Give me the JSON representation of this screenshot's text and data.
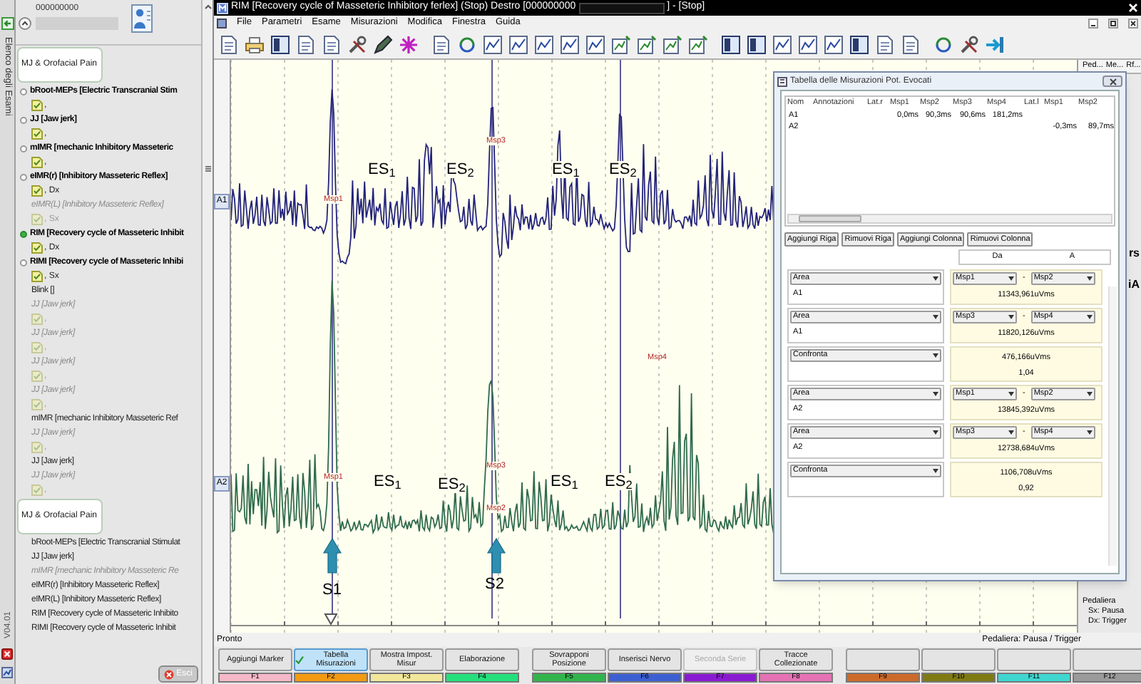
{
  "window": {
    "title": "RIM [Recovery cycle of Masseteric Inhibitory ferlex] (Stop) Destro [000000000",
    "title_end": "] - [Stop]"
  },
  "menu": [
    "File",
    "Parametri",
    "Esame",
    "Misurazioni",
    "Modifica",
    "Finestra",
    "Guida"
  ],
  "sidebar": {
    "tab_label": "Elenco degli Esami",
    "patient_id": "000000000",
    "version": "V04.01",
    "exit_button": "Esci",
    "groups": [
      {
        "title": "MJ & Orofacial Pain",
        "items": [
          {
            "kind": "exam",
            "text": "bRoot-MEPs [Electric Transcranial Stim",
            "active": false
          },
          {
            "kind": "file",
            "text": ",",
            "dimmed": false
          },
          {
            "kind": "exam",
            "text": "JJ [Jaw jerk]",
            "active": false
          },
          {
            "kind": "file",
            "text": ",",
            "dimmed": false
          },
          {
            "kind": "exam",
            "text": "mIMR [mechanic Inhibitory Masseteric",
            "active": false
          },
          {
            "kind": "file",
            "text": ",",
            "dimmed": false
          },
          {
            "kind": "exam",
            "text": "eIMR(r) [Inhibitory Masseteric Reflex]",
            "active": false
          },
          {
            "kind": "file",
            "text": ", Dx",
            "dimmed": false
          },
          {
            "kind": "note",
            "text": "eIMR(L) [Inhibitory Masseteric Reflex]"
          },
          {
            "kind": "file",
            "text": ", Sx",
            "dimmed": true
          },
          {
            "kind": "exam",
            "text": "RIM [Recovery cycle of Masseteric Inhibit",
            "active": true
          },
          {
            "kind": "file",
            "text": ", Dx",
            "dimmed": false
          },
          {
            "kind": "exam",
            "text": "RIMI [Recovery cycle of Masseteric Inhibi",
            "active": false
          },
          {
            "kind": "file",
            "text": ", Sx",
            "dimmed": false
          },
          {
            "kind": "entry",
            "text": "Blink []"
          },
          {
            "kind": "note",
            "text": "JJ [Jaw jerk]"
          },
          {
            "kind": "file",
            "text": ",",
            "dimmed": true
          },
          {
            "kind": "note",
            "text": "JJ [Jaw jerk]"
          },
          {
            "kind": "file",
            "text": ",",
            "dimmed": true
          },
          {
            "kind": "note",
            "text": "JJ [Jaw jerk]"
          },
          {
            "kind": "file",
            "text": ",",
            "dimmed": true
          },
          {
            "kind": "note",
            "text": "JJ [Jaw jerk]"
          },
          {
            "kind": "file",
            "text": ",",
            "dimmed": true
          },
          {
            "kind": "entry",
            "text": "mIMR [mechanic Inhibitory Masseteric Ref"
          },
          {
            "kind": "note",
            "text": "JJ [Jaw jerk]"
          },
          {
            "kind": "file",
            "text": ",",
            "dimmed": true
          },
          {
            "kind": "entry",
            "text": "JJ [Jaw jerk]"
          },
          {
            "kind": "note",
            "text": "JJ [Jaw jerk]"
          },
          {
            "kind": "file",
            "text": ",",
            "dimmed": true
          }
        ]
      },
      {
        "title": "MJ & Orofacial Pain",
        "items": [
          {
            "kind": "entry",
            "text": "bRoot-MEPs [Electric Transcranial Stimulat"
          },
          {
            "kind": "entry",
            "text": "JJ [Jaw jerk]"
          },
          {
            "kind": "note",
            "text": "mIMR [mechanic Inhibitory Masseteric Re"
          },
          {
            "kind": "entry",
            "text": "eIMR(r) [Inhibitory Masseteric Reflex]"
          },
          {
            "kind": "entry",
            "text": "eIMR(L) [Inhibitory Masseteric Reflex]"
          },
          {
            "kind": "entry",
            "text": "RIM [Recovery cycle of Masseteric Inhibito"
          },
          {
            "kind": "entry",
            "text": "RIMI [Recovery cycle of Masseteric Inhibit"
          }
        ]
      }
    ]
  },
  "chart": {
    "channels": [
      {
        "label": "A1",
        "color": "#23237a",
        "segments": [
          "ES$_{1}$",
          "ES$_{2}$",
          "ES$_{1}$",
          "ES$_{2}$"
        ],
        "markers": [
          "Msp1",
          "Msp3"
        ]
      },
      {
        "label": "A2",
        "color": "#2f6b4c",
        "segments": [
          "ES$_{1}$",
          "ES$_{2}$",
          "ES$_{1}$",
          "ES$_{2}$"
        ],
        "markers": [
          "Msp4",
          "Msp1",
          "Msp3",
          "Msp2"
        ]
      }
    ],
    "stimuli": [
      "S1",
      "S2"
    ]
  },
  "right_panel": {
    "columns": [
      "Ped...",
      "Me...",
      "Rf..."
    ],
    "fragments": [
      "rs",
      "iA"
    ],
    "pedal_title": "Pedaliera",
    "pedal_lines": [
      "Sx: Pausa",
      "Dx: Trigger"
    ]
  },
  "measurements_window": {
    "title": "Tabella delle Misurazioni Pot. Evocati",
    "columns": [
      "Nom",
      "Annotazioni",
      "Lat.r",
      "Msp1",
      "Msp2",
      "Msp3",
      "Msp4",
      "Lat.l",
      "Msp1",
      "Msp2"
    ],
    "rows": [
      {
        "cells": [
          "A1",
          null,
          null,
          "0,0ms",
          "90,3ms",
          "90,6ms",
          "181,2ms",
          null,
          null,
          null
        ]
      },
      {
        "cells": [
          "A2",
          null,
          null,
          null,
          null,
          null,
          null,
          null,
          "-0,3ms",
          "89,7ms"
        ]
      }
    ],
    "buttons": [
      "Aggiungi Riga",
      "Rimuovi Riga",
      "Aggiungi Colonna",
      "Rimuovi Colonna"
    ],
    "range_headers": [
      "Da",
      "A"
    ],
    "measures": [
      {
        "kind": "area",
        "type": "Area",
        "channel": "A1",
        "from": "Msp1",
        "separator": "-",
        "to": "Msp2",
        "value": "11343,961uVms"
      },
      {
        "kind": "area",
        "type": "Area",
        "channel": "A1",
        "from": "Msp3",
        "separator": "-",
        "to": "Msp4",
        "value": "11820,126uVms"
      },
      {
        "kind": "compare",
        "type": "Confronta",
        "difference": "476,166uVms",
        "ratio": "1,04"
      },
      {
        "kind": "area",
        "type": "Area",
        "channel": "A2",
        "from": "Msp1",
        "separator": "-",
        "to": "Msp2",
        "value": "13845,392uVms"
      },
      {
        "kind": "area",
        "type": "Area",
        "channel": "A2",
        "from": "Msp3",
        "separator": "-",
        "to": "Msp4",
        "value": "12738,684uVms"
      },
      {
        "kind": "compare",
        "type": "Confronta",
        "difference": "1106,708uVms",
        "ratio": "0,92"
      }
    ]
  },
  "status_bar": {
    "left": "Pronto",
    "right": "Pedaliera: Pausa / Trigger"
  },
  "function_keys": [
    {
      "label": "Aggiungi Marker",
      "key": "F1",
      "color": "#f5b8c8",
      "selected": false,
      "disabled": false
    },
    {
      "label": "Tabella Misurazioni",
      "key": "F2",
      "color": "#f39a12",
      "selected": true,
      "disabled": false
    },
    {
      "label": "Mostra Impost. Misur",
      "key": "F3",
      "color": "#f2e69a",
      "selected": false,
      "disabled": false
    },
    {
      "label": "Elaborazione",
      "key": "F4",
      "color": "#24e07c",
      "selected": false,
      "disabled": false
    },
    {
      "label": "Sovrapponi Posizione",
      "key": "F5",
      "color": "#32b44c",
      "selected": false,
      "disabled": false
    },
    {
      "label": "Inserisci Nervo",
      "key": "F6",
      "color": "#3c5fd2",
      "selected": false,
      "disabled": false
    },
    {
      "label": "Seconda Serie",
      "key": "F7",
      "color": "#8a1ad2",
      "selected": false,
      "disabled": true
    },
    {
      "label": "Tracce Collezionate",
      "key": "F8",
      "color": "#e472b4",
      "selected": false,
      "disabled": false
    },
    {
      "key": "F9",
      "color": "#cc6a2a",
      "selected": false,
      "disabled": false
    },
    {
      "key": "F10",
      "color": "#7f7a12",
      "selected": false,
      "disabled": false
    },
    {
      "key": "F11",
      "color": "#40d6d0",
      "selected": false,
      "disabled": false
    },
    {
      "key": "F12",
      "color": "#9a9a9a",
      "selected": false,
      "disabled": false
    }
  ]
}
